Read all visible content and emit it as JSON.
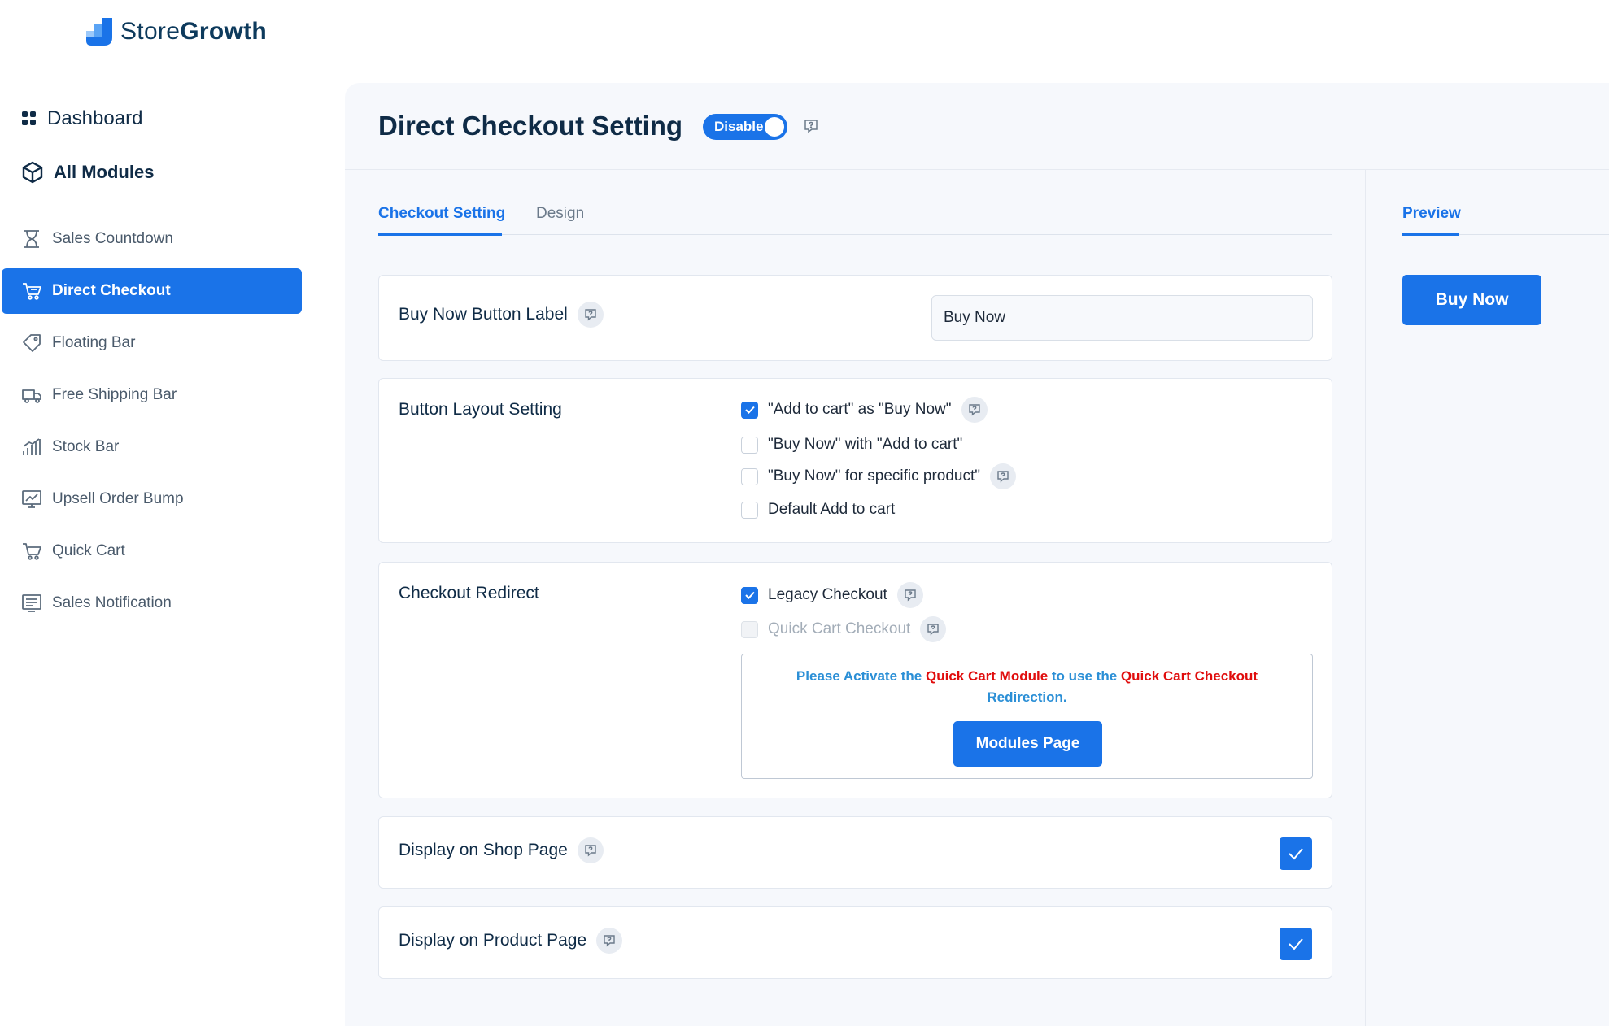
{
  "brand": {
    "name_part1": "Store",
    "name_part2": "Growth"
  },
  "sidebar": {
    "dashboard": "Dashboard",
    "all_modules": "All Modules",
    "items": [
      {
        "label": "Sales Countdown",
        "icon": "hourglass-icon"
      },
      {
        "label": "Direct Checkout",
        "icon": "cart-icon",
        "active": true
      },
      {
        "label": "Floating Bar",
        "icon": "tag-icon"
      },
      {
        "label": "Free Shipping Bar",
        "icon": "truck-icon"
      },
      {
        "label": "Stock Bar",
        "icon": "bar-chart-icon"
      },
      {
        "label": "Upsell Order Bump",
        "icon": "trend-icon"
      },
      {
        "label": "Quick Cart",
        "icon": "cart-icon"
      },
      {
        "label": "Sales Notification",
        "icon": "notification-icon"
      }
    ]
  },
  "header": {
    "title": "Direct Checkout Setting",
    "toggle_label": "Disable"
  },
  "tabs": {
    "checkout": "Checkout Setting",
    "design": "Design",
    "preview": "Preview"
  },
  "buy_now_label": {
    "label": "Buy Now Button Label",
    "value": "Buy Now"
  },
  "button_layout": {
    "label": "Button Layout Setting",
    "options": [
      {
        "label": "\"Add to cart\" as \"Buy Now\"",
        "checked": true
      },
      {
        "label": "\"Buy Now\" with \"Add to cart\"",
        "checked": false
      },
      {
        "label": "\"Buy Now\" for specific product\"",
        "checked": false
      },
      {
        "label": "Default Add to cart",
        "checked": false
      }
    ]
  },
  "checkout_redirect": {
    "label": "Checkout Redirect",
    "options": [
      {
        "label": "Legacy Checkout",
        "checked": true
      },
      {
        "label": "Quick Cart Checkout",
        "checked": false,
        "disabled": true
      }
    ],
    "notice": {
      "t1": "Please Activate the ",
      "t2": "Quick Cart Module",
      "t3": " to use the ",
      "t4": "Quick Cart Checkout",
      "t5": " Redirection."
    },
    "modules_button": "Modules Page"
  },
  "display_shop": {
    "label": "Display on Shop Page",
    "checked": true
  },
  "display_product": {
    "label": "Display on Product Page",
    "checked": true
  },
  "preview": {
    "button": "Buy Now"
  },
  "colors": {
    "accent": "#1a73e8",
    "notice_blue": "#2b8fd6",
    "notice_red": "#e00d0d",
    "heading": "#0f2b46"
  }
}
